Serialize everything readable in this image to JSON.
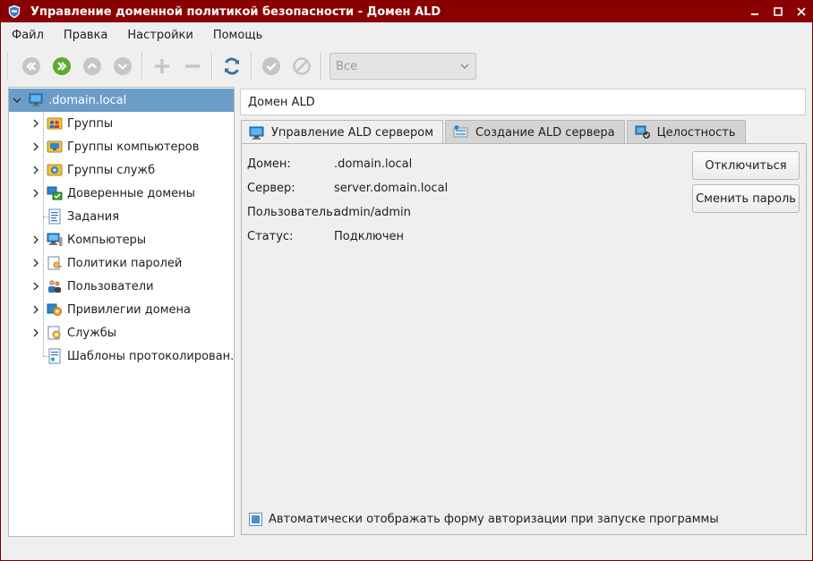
{
  "window": {
    "title": "Управление доменной политикой безопасности - Домен ALD",
    "colors": {
      "titlebar": "#8b0000",
      "selection": "#6c9cc8",
      "accent": "#4a90d0"
    }
  },
  "menu": {
    "items": [
      "Файл",
      "Правка",
      "Настройки",
      "Помощь"
    ]
  },
  "toolbar": {
    "icons": [
      "double-left-icon",
      "double-right-icon",
      "chevron-up-icon",
      "chevron-down-icon",
      "plus-icon",
      "minus-icon",
      "refresh-icon",
      "check-icon",
      "cancel-icon"
    ],
    "filter": {
      "selected": "Все"
    }
  },
  "tree": {
    "root": ".domain.local",
    "items": [
      "Группы",
      "Группы компьютеров",
      "Группы служб",
      "Доверенные домены",
      "Задания",
      "Компьютеры",
      "Политики паролей",
      "Пользователи",
      "Привилегии домена",
      "Службы",
      "Шаблоны протоколирован..."
    ]
  },
  "main": {
    "header": "Домен ALD",
    "tabs": [
      "Управление ALD сервером",
      "Создание ALD сервера",
      "Целостность"
    ],
    "info": [
      {
        "label": "Домен:",
        "value": ".domain.local"
      },
      {
        "label": "Сервер:",
        "value": "server.domain.local"
      },
      {
        "label": "Пользователь:",
        "value": "admin/admin"
      },
      {
        "label": "Статус:",
        "value": "Подключен"
      }
    ],
    "buttons": {
      "disconnect": "Отключиться",
      "change_password": "Сменить пароль"
    },
    "auto_login": {
      "label": "Автоматически отображать форму авторизации при запуске программы",
      "checked": true
    }
  }
}
